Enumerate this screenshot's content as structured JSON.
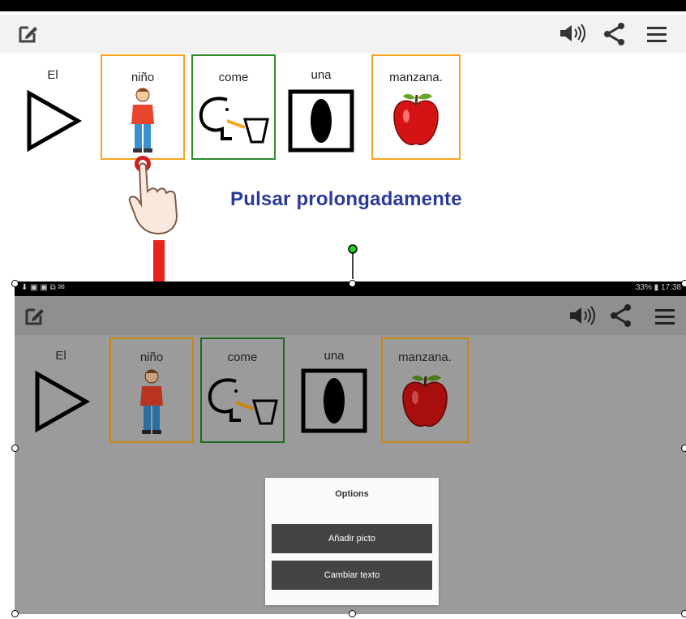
{
  "top": {
    "status_text": "",
    "words": [
      {
        "label": "El",
        "pic": "play-triangle-icon",
        "border": ""
      },
      {
        "label": "niño",
        "pic": "boy-icon",
        "border": "#f5a623"
      },
      {
        "label": "come",
        "pic": "eat-icon",
        "border": "#2e8b2e"
      },
      {
        "label": "una",
        "pic": "oval-icon",
        "border": ""
      },
      {
        "label": "manzana.",
        "pic": "apple-icon",
        "border": "#f5a623"
      }
    ]
  },
  "hint": "Pulsar prolongadamente",
  "bottom": {
    "status_left": "⬇ ▣ ▣ ⧉ ✉",
    "status_right": "33% ▮ 17:38",
    "words": [
      {
        "label": "El"
      },
      {
        "label": "niño"
      },
      {
        "label": "come"
      },
      {
        "label": "una"
      },
      {
        "label": "manzana."
      }
    ],
    "dialog": {
      "title": "Options",
      "buttons": [
        "Añadir picto",
        "Cambiar texto"
      ]
    }
  },
  "colors": {
    "orange_border": "#f5a623",
    "green_border": "#2e8b2e",
    "hint_text": "#2b3a9a",
    "arrow": "#e8231a",
    "overlay_gray": "#9b9b9b"
  }
}
